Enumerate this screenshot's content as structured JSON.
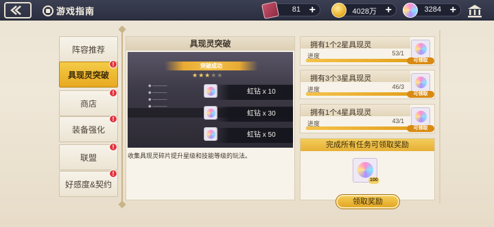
{
  "header": {
    "title": "游戏指南",
    "resources": [
      {
        "name": "ticket",
        "value": "81"
      },
      {
        "name": "gold",
        "value": "4028万"
      },
      {
        "name": "rainbow-gem",
        "value": "3284"
      }
    ]
  },
  "sidebar": {
    "items": [
      {
        "label": "阵容推荐",
        "badge": ""
      },
      {
        "label": "具现灵突破",
        "badge": "!"
      },
      {
        "label": "商店",
        "badge": "!"
      },
      {
        "label": "装备强化",
        "badge": "!"
      },
      {
        "label": "联盟",
        "badge": "!"
      },
      {
        "label": "好感度&契约",
        "badge": "!"
      }
    ],
    "active_index": 1
  },
  "center": {
    "title": "具现灵突破",
    "preview": {
      "banner": "突破成功",
      "gems": [
        {
          "label": "虹钻 x 10"
        },
        {
          "label": "虹钻 x 30"
        },
        {
          "label": "虹钻 x 50"
        }
      ]
    },
    "description": "收集具现灵碎片提升星级和技能等级的玩法。"
  },
  "tasks": [
    {
      "title": "拥有1个2星具现灵",
      "progress_label": "进度",
      "progress_text": "53/1",
      "progress_fraction": 1.0,
      "status": "可领取"
    },
    {
      "title": "拥有3个3星具现灵",
      "progress_label": "进度",
      "progress_text": "46/3",
      "progress_fraction": 1.0,
      "status": "可领取"
    },
    {
      "title": "拥有1个4星具现灵",
      "progress_label": "进度",
      "progress_text": "43/1",
      "progress_fraction": 1.0,
      "status": "可领取"
    }
  ],
  "bonus": {
    "title": "完成所有任务可领取奖励",
    "quantity": "100",
    "claim_label": "领取奖励"
  }
}
